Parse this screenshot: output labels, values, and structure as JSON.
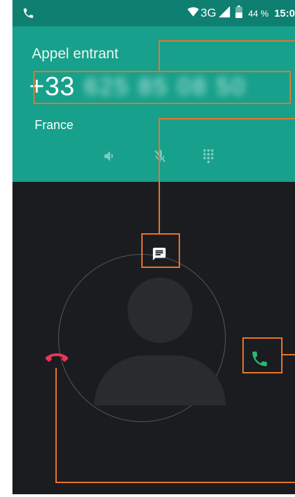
{
  "status_bar": {
    "network": "3G",
    "battery": "44 %",
    "time": "15:0",
    "icons": [
      "call-indicator-icon",
      "wifi-icon",
      "signal-icon",
      "battery-icon"
    ]
  },
  "call": {
    "state": "Appel entrant",
    "number_prefix": "+33",
    "number_blurred": "625 85 08 50",
    "location": "France"
  },
  "controls": [
    "speaker-icon",
    "mute-icon",
    "dialpad-icon"
  ],
  "actions": {
    "message": "message-icon",
    "answer": "answer-phone-icon",
    "decline": "decline-phone-icon"
  },
  "colors": {
    "header": "#17a08b",
    "status_bar": "#0e7f70",
    "background": "#1b1c1f",
    "answer": "#2bb673",
    "decline": "#e9355a",
    "annotation": "#e8742c"
  }
}
